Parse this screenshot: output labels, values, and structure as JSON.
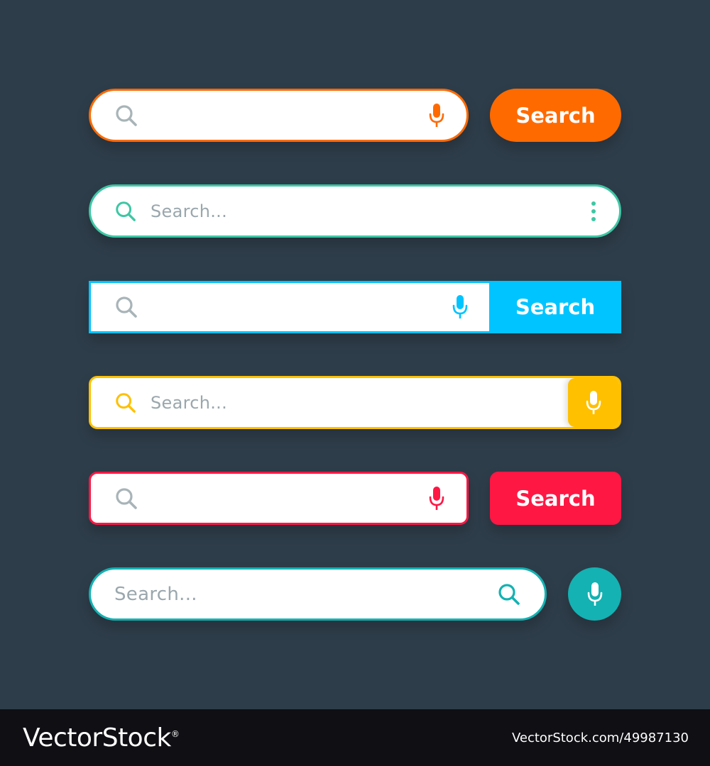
{
  "colors": {
    "background": "#2e3d4a",
    "orange": "#ff6a00",
    "green": "#3ec7a4",
    "blue": "#00c4ff",
    "yellow": "#ffc000",
    "red": "#ff1744",
    "teal": "#14b2b2",
    "icon_gray": "#a8b4b8"
  },
  "bars": [
    {
      "style": "rounded-orange",
      "placeholder": "",
      "left_icon": "search-icon",
      "right_icon": "microphone-icon",
      "button_label": "Search"
    },
    {
      "style": "rounded-green",
      "placeholder": "Search...",
      "left_icon": "search-icon",
      "right_icon": "more-vertical-icon"
    },
    {
      "style": "square-blue",
      "placeholder": "",
      "left_icon": "search-icon",
      "right_icon": "microphone-icon",
      "button_label": "Search"
    },
    {
      "style": "rounded-yellow",
      "placeholder": "Search...",
      "left_icon": "search-icon",
      "right_icon": "microphone-icon"
    },
    {
      "style": "rounded-red",
      "placeholder": "",
      "left_icon": "search-icon",
      "right_icon": "microphone-icon",
      "button_label": "Search"
    },
    {
      "style": "pill-teal",
      "placeholder": "Search...",
      "right_icon": "search-icon",
      "extra_button_icon": "microphone-icon"
    }
  ],
  "footer": {
    "brand": "VectorStock",
    "brand_mark": "®",
    "image_id": "VectorStock.com/49987130"
  }
}
